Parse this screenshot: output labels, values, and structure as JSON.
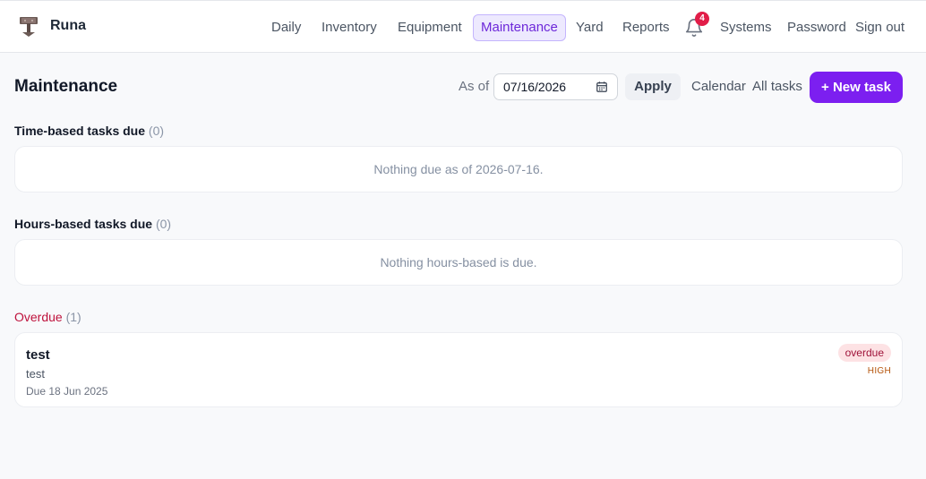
{
  "app": {
    "name": "Runa"
  },
  "nav": {
    "items": [
      {
        "label": "Daily"
      },
      {
        "label": "Inventory"
      },
      {
        "label": "Equipment"
      },
      {
        "label": "Maintenance",
        "active": true
      },
      {
        "label": "Yard"
      },
      {
        "label": "Reports"
      },
      {
        "label": "Systems"
      },
      {
        "label": "Password"
      },
      {
        "label": "Sign out"
      }
    ],
    "notifications": {
      "icon": "bell-icon",
      "count": "4"
    }
  },
  "page": {
    "title": "Maintenance",
    "as_of_label": "As of",
    "date_value": "07/16/2026",
    "apply_label": "Apply",
    "calendar_label": "Calendar",
    "all_tasks_label": "All tasks",
    "new_task_label": "+ New task"
  },
  "sections": {
    "time_based": {
      "title": "Time-based tasks due",
      "count": "(0)",
      "empty": "Nothing due as of 2026-07-16."
    },
    "hours_based": {
      "title": "Hours-based tasks due",
      "count": "(0)",
      "empty": "Nothing hours-based is due."
    },
    "overdue": {
      "title": "Overdue",
      "count": "(1)",
      "tasks": [
        {
          "title": "test",
          "description": "test",
          "due": "Due 18 Jun 2025",
          "status": "overdue",
          "priority": "HIGH"
        }
      ]
    }
  },
  "colors": {
    "accent": "#7c1ff0",
    "active_nav_bg": "#ede9fe",
    "overdue_text": "#be123c",
    "badge": "#e11d48",
    "priority_high": "#b45309"
  }
}
